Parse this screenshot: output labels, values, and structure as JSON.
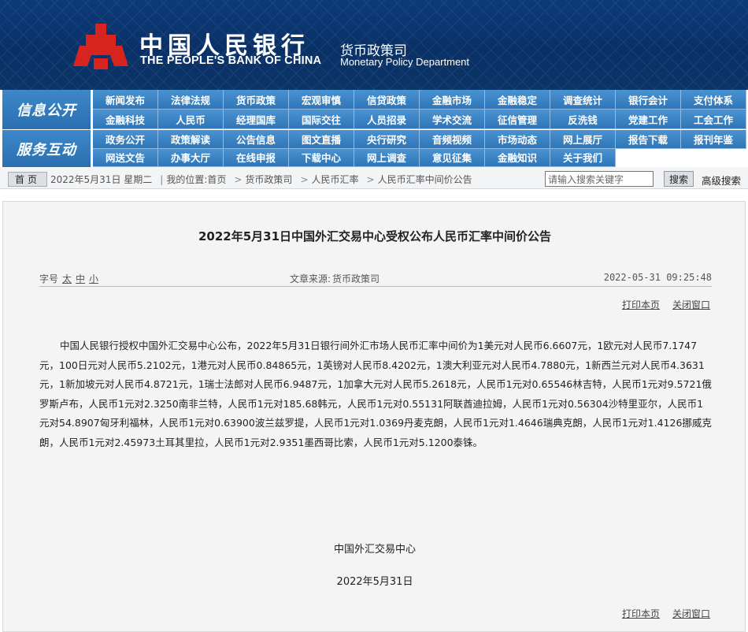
{
  "header": {
    "org_cn": "中国人民银行",
    "org_en": "THE PEOPLE'S BANK OF CHINA",
    "dept_cn": "货币政策司",
    "dept_en": "Monetary Policy Department"
  },
  "nav": {
    "section1": "信息公开",
    "section2": "服务互动",
    "row1": [
      "新闻发布",
      "法律法规",
      "货币政策",
      "宏观审慎",
      "信贷政策",
      "金融市场",
      "金融稳定",
      "调查统计",
      "银行会计",
      "支付体系",
      "金融科技",
      "人民币",
      "经理国库",
      "国际交往",
      "人员招录",
      "学术交流",
      "征信管理",
      "反洗钱",
      "党建工作",
      "工会工作"
    ],
    "row2": [
      "政务公开",
      "政策解读",
      "公告信息",
      "图文直播",
      "央行研究",
      "音频视频",
      "市场动态",
      "网上展厅",
      "报告下载",
      "报刊年鉴",
      "网送文告",
      "办事大厅",
      "在线申报",
      "下载中心",
      "网上调查",
      "意见征集",
      "金融知识",
      "关于我们"
    ]
  },
  "breadcrumb": {
    "home_label": "首页",
    "date": "2022年5月31日 星期二",
    "location_label": "我的位置:首页",
    "items": [
      "货币政策司",
      "人民币汇率",
      "人民币汇率中间价公告"
    ],
    "search_placeholder": "请输入搜索关键字",
    "search_button": "搜索",
    "advanced_search": "高级搜索"
  },
  "article": {
    "title": "2022年5月31日中国外汇交易中心受权公布人民币汇率中间价公告",
    "font_size_label": "字号",
    "font_sizes": [
      "太",
      "中",
      "小"
    ],
    "source_label": "文章来源:",
    "source": "货币政策司",
    "datetime": "2022-05-31 09:25:48",
    "print_label": "打印本页",
    "close_label": "关闭窗口",
    "body": "中国人民银行授权中国外汇交易中心公布，2022年5月31日银行间外汇市场人民币汇率中间价为1美元对人民币6.6607元，1欧元对人民币7.1747元，100日元对人民币5.2102元，1港元对人民币0.84865元，1英镑对人民币8.4202元，1澳大利亚元对人民币4.7880元，1新西兰元对人民币4.3631元，1新加坡元对人民币4.8721元，1瑞士法郎对人民币6.9487元，1加拿大元对人民币5.2618元，人民币1元对0.65546林吉特，人民币1元对9.5721俄罗斯卢布，人民币1元对2.3250南非兰特，人民币1元对185.68韩元，人民币1元对0.55131阿联酋迪拉姆，人民币1元对0.56304沙特里亚尔，人民币1元对54.8907匈牙利福林，人民币1元对0.63900波兰兹罗提，人民币1元对1.0369丹麦克朗，人民币1元对1.4646瑞典克朗，人民币1元对1.4126挪威克朗，人民币1元对2.45973土耳其里拉，人民币1元对2.9351墨西哥比索，人民币1元对5.1200泰铢。",
    "signature_org": "中国外汇交易中心",
    "signature_date": "2022年5月31日"
  },
  "colors": {
    "header_bg": "#0a3166",
    "nav_blue": "#2f75b7",
    "logo_red": "#d8241f"
  }
}
